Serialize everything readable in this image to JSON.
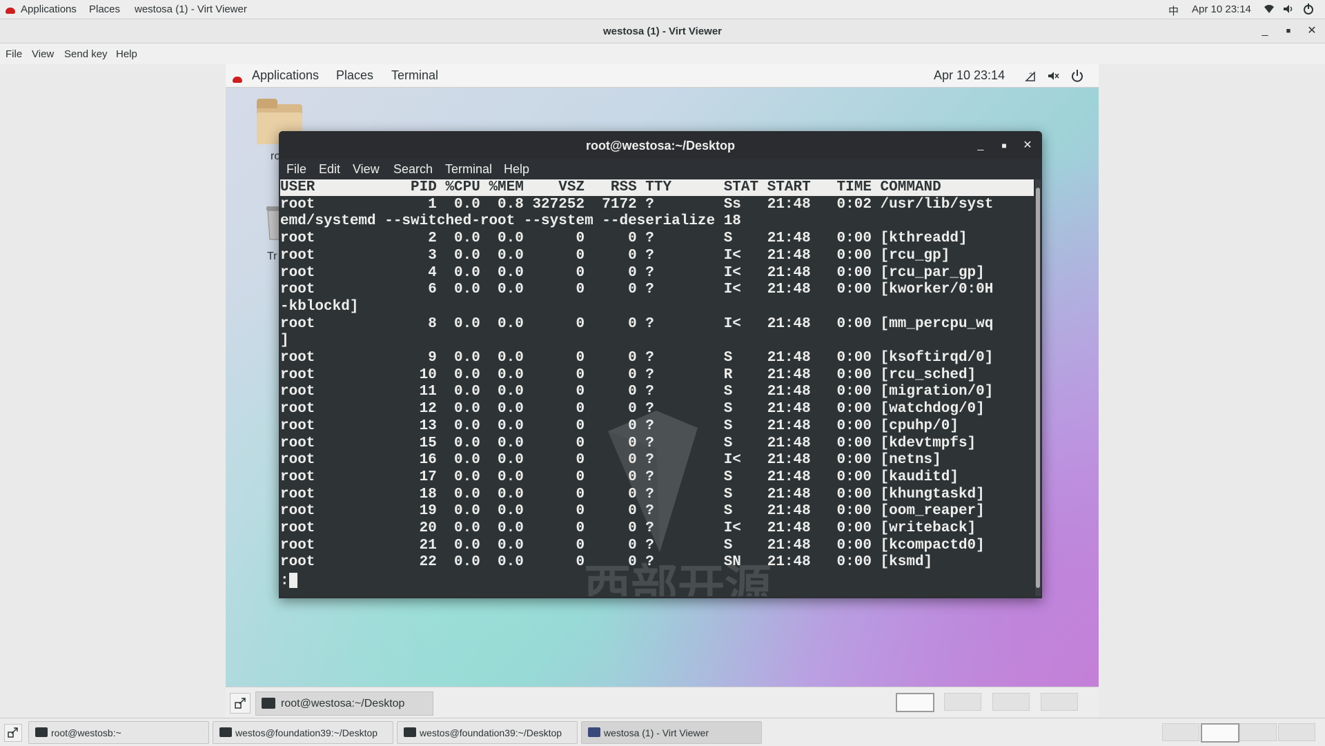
{
  "host_topbar": {
    "applications": "Applications",
    "places": "Places",
    "window_title": "westosa (1) - Virt Viewer",
    "input_method": "中",
    "clock": "Apr 10  23:14"
  },
  "viewer": {
    "title": "westosa (1) - Virt Viewer",
    "menu": [
      "File",
      "View",
      "Send key",
      "Help"
    ]
  },
  "guest_topbar": {
    "applications": "Applications",
    "places": "Places",
    "terminal": "Terminal",
    "clock": "Apr 10  23:14"
  },
  "desktop_icons": {
    "home_label": "ro",
    "trash_label": "Tr"
  },
  "terminal": {
    "title": "root@westosa:~/Desktop",
    "menu": [
      "File",
      "Edit",
      "View",
      "Search",
      "Terminal",
      "Help"
    ],
    "header": "USER           PID %CPU %MEM    VSZ   RSS TTY      STAT START   TIME COMMAND",
    "lines": [
      "root             1  0.0  0.8 327252  7172 ?        Ss   21:48   0:02 /usr/lib/syst",
      "emd/systemd --switched-root --system --deserialize 18",
      "root             2  0.0  0.0      0     0 ?        S    21:48   0:00 [kthreadd]",
      "root             3  0.0  0.0      0     0 ?        I<   21:48   0:00 [rcu_gp]",
      "root             4  0.0  0.0      0     0 ?        I<   21:48   0:00 [rcu_par_gp]",
      "root             6  0.0  0.0      0     0 ?        I<   21:48   0:00 [kworker/0:0H",
      "-kblockd]",
      "root             8  0.0  0.0      0     0 ?        I<   21:48   0:00 [mm_percpu_wq",
      "]",
      "root             9  0.0  0.0      0     0 ?        S    21:48   0:00 [ksoftirqd/0]",
      "root            10  0.0  0.0      0     0 ?        R    21:48   0:00 [rcu_sched]",
      "root            11  0.0  0.0      0     0 ?        S    21:48   0:00 [migration/0]",
      "root            12  0.0  0.0      0     0 ?        S    21:48   0:00 [watchdog/0]",
      "root            13  0.0  0.0      0     0 ?        S    21:48   0:00 [cpuhp/0]",
      "root            15  0.0  0.0      0     0 ?        S    21:48   0:00 [kdevtmpfs]",
      "root            16  0.0  0.0      0     0 ?        I<   21:48   0:00 [netns]",
      "root            17  0.0  0.0      0     0 ?        S    21:48   0:00 [kauditd]",
      "root            18  0.0  0.0      0     0 ?        S    21:48   0:00 [khungtaskd]",
      "root            19  0.0  0.0      0     0 ?        S    21:48   0:00 [oom_reaper]",
      "root            20  0.0  0.0      0     0 ?        I<   21:48   0:00 [writeback]",
      "root            21  0.0  0.0      0     0 ?        S    21:48   0:00 [kcompactd0]",
      "root            22  0.0  0.0      0     0 ?        SN   21:48   0:00 [ksmd]"
    ],
    "prompt": ":"
  },
  "watermark": "西部开源",
  "guest_panel": {
    "task": "root@westosa:~/Desktop"
  },
  "host_taskbar": {
    "tasks": [
      "root@westosb:~",
      "westos@foundation39:~/Desktop",
      "westos@foundation39:~/Desktop",
      "westosa (1) - Virt Viewer"
    ]
  }
}
